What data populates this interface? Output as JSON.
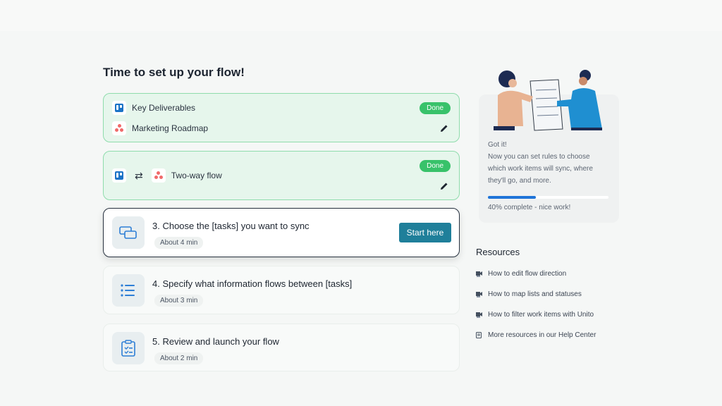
{
  "page": {
    "title": "Time to set up your flow!",
    "background": "#f5f7f6"
  },
  "steps": {
    "step1": {
      "source_app": "Key Deliverables",
      "target_app": "Marketing Roadmap",
      "status": "Done",
      "source_icon": "trello-icon",
      "target_icon": "asana-icon",
      "edit_icon": "pencil-icon"
    },
    "step2": {
      "label": "Two-way flow",
      "status": "Done",
      "direction_icon": "two-way-arrows-icon",
      "edit_icon": "pencil-icon"
    },
    "step3": {
      "title": "3. Choose the [tasks] you want to sync",
      "duration": "About 4 min",
      "button": "Start here",
      "icon": "cards-icon"
    },
    "step4": {
      "title": "4. Specify what information flows between [tasks]",
      "duration": "About 3 min",
      "icon": "list-icon"
    },
    "step5": {
      "title": "5. Review and launch your flow",
      "duration": "About 2 min",
      "icon": "clipboard-check-icon"
    }
  },
  "progress_panel": {
    "heading": "Got it!",
    "line1": "Now you can set rules to choose",
    "line2": "which work items will sync, where",
    "line3": "they'll go, and more.",
    "progress_percent": 40,
    "progress_label": "40% complete - nice work!"
  },
  "resources": {
    "title": "Resources",
    "items": [
      {
        "label": "How to edit flow direction",
        "icon": "video-icon"
      },
      {
        "label": "How to map lists and statuses",
        "icon": "video-icon"
      },
      {
        "label": "How to filter work items with Unito",
        "icon": "video-icon"
      },
      {
        "label": "More resources in our Help Center",
        "icon": "book-icon"
      }
    ]
  },
  "colors": {
    "done_green": "#38c26a",
    "done_bg": "#e6f6ec",
    "accent_button": "#1f7f9a",
    "progress": "#1f74d8",
    "trello_blue": "#1b73c7",
    "asana_coral": "#f06a6a"
  }
}
